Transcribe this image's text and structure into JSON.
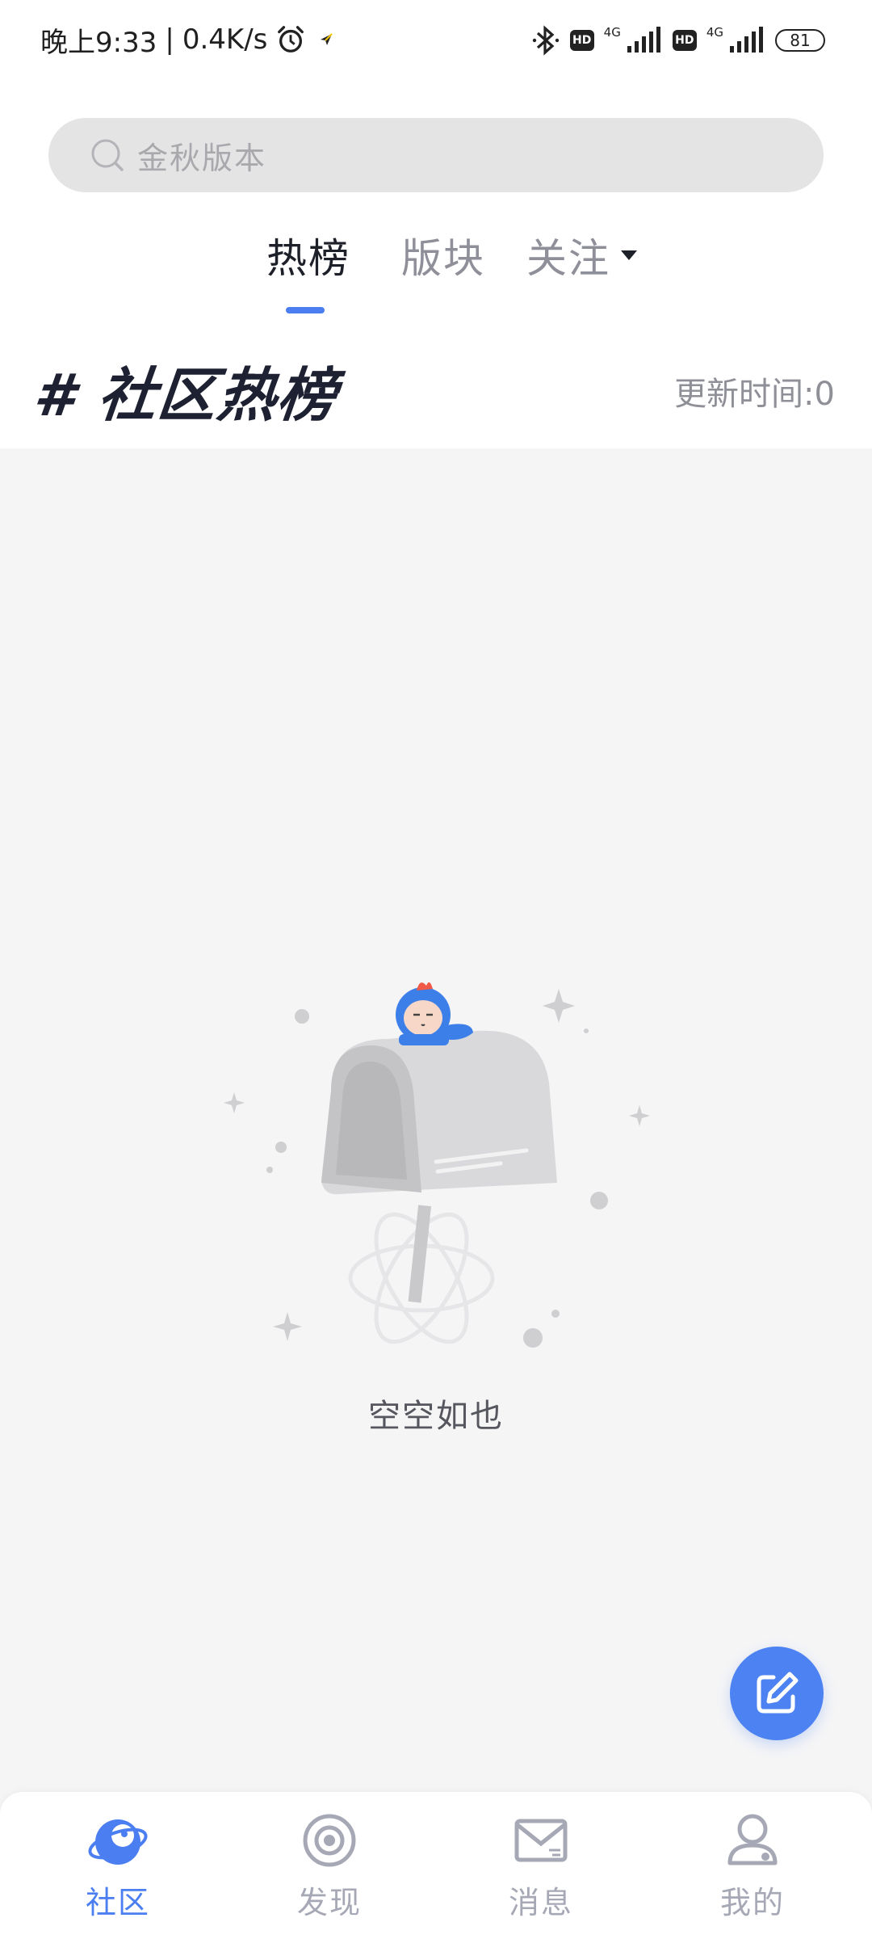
{
  "status_bar": {
    "time_text": "晚上9:33",
    "separator": "|",
    "net_speed": "0.4K/s",
    "hd_label": "HD",
    "network_label": "4G",
    "battery": "81",
    "icons": [
      "alarm-icon",
      "navigation-icon",
      "bluetooth-icon",
      "signal-icon",
      "battery-icon"
    ]
  },
  "search": {
    "placeholder": "金秋版本"
  },
  "tabs": [
    {
      "label": "热榜",
      "active": true
    },
    {
      "label": "版块",
      "active": false
    },
    {
      "label": "关注",
      "active": false
    }
  ],
  "section": {
    "title": "# 社区热榜",
    "update_time": "更新时间:0"
  },
  "empty_state": {
    "text": "空空如也"
  },
  "bottom_nav": [
    {
      "label": "社区",
      "icon": "planet-icon",
      "active": true
    },
    {
      "label": "发现",
      "icon": "target-icon",
      "active": false
    },
    {
      "label": "消息",
      "icon": "mail-icon",
      "active": false
    },
    {
      "label": "我的",
      "icon": "user-icon",
      "active": false
    }
  ],
  "colors": {
    "accent": "#4b7ef0",
    "background": "#f5f5f6",
    "title_text": "#1d2131",
    "muted_text": "#8e8f97"
  }
}
